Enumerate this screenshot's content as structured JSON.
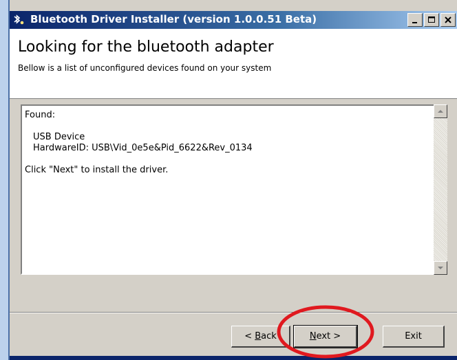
{
  "window": {
    "title": "Bluetooth Driver Installer (version 1.0.0.51 Beta)",
    "icon": "bluetooth-icon",
    "controls": [
      "minimize-icon",
      "maximize-icon",
      "close-icon"
    ]
  },
  "header": {
    "title": "Looking for the bluetooth adapter",
    "subtitle": "Bellow is a list of unconfigured devices found on your system"
  },
  "output": {
    "found_label": "Found:",
    "device_name": "USB Device",
    "hardware_id": "HardwareID: USB\\Vid_0e5e&Pid_6622&Rev_0134",
    "instruction": "Click \"Next\" to install the driver."
  },
  "buttons": {
    "back": {
      "prefix": "< ",
      "mnemonic": "B",
      "rest": "ack"
    },
    "next": {
      "mnemonic": "N",
      "rest": "ext >"
    },
    "exit": "Exit"
  },
  "colors": {
    "titlebar_start": "#0a246a",
    "titlebar_end": "#a6caf0",
    "face": "#d4d0c8",
    "annotation": "#e0191f"
  }
}
